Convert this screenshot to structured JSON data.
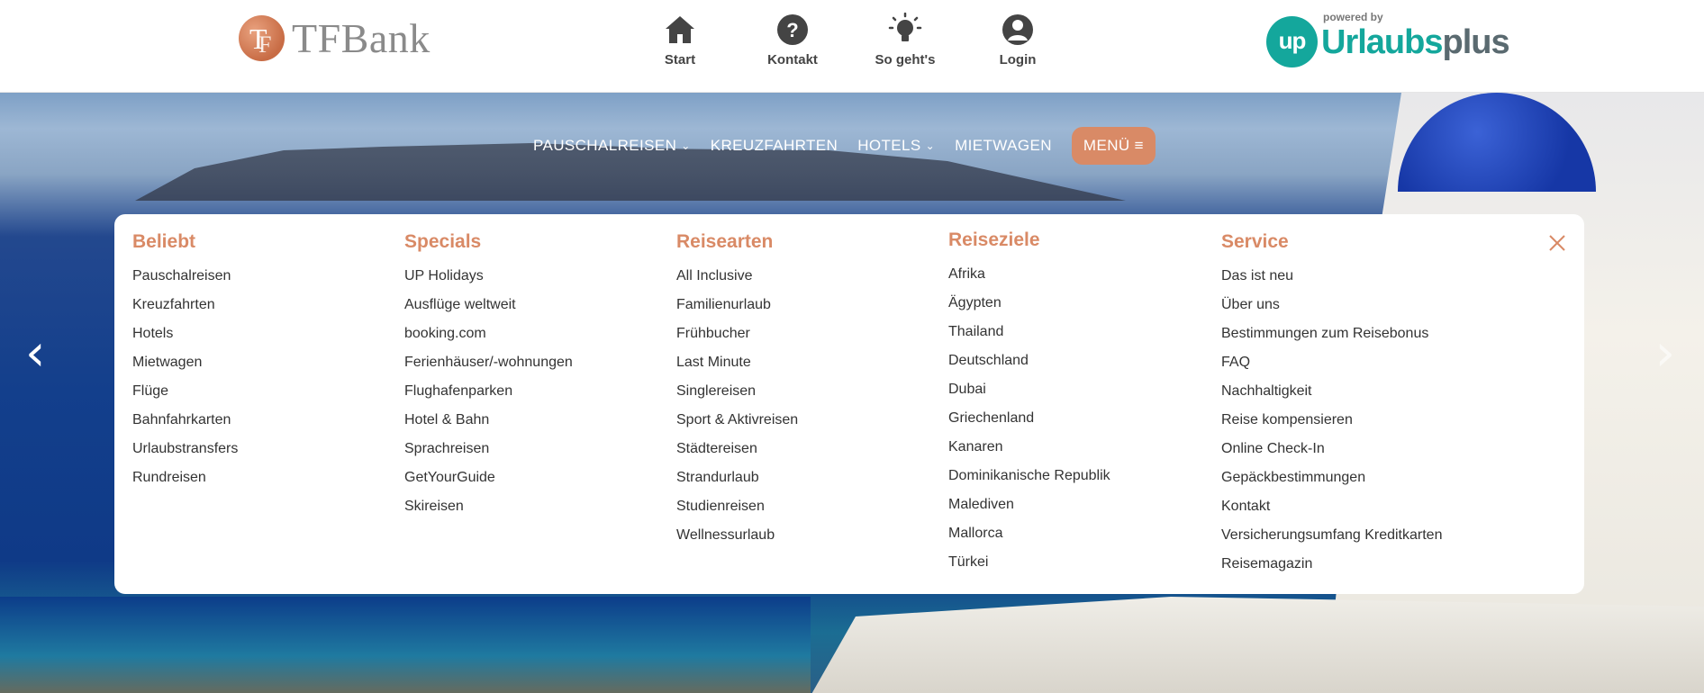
{
  "header": {
    "logo_text": "TFBank",
    "nav": [
      {
        "label": "Start",
        "icon": "home-icon"
      },
      {
        "label": "Kontakt",
        "icon": "question-icon"
      },
      {
        "label": "So geht's",
        "icon": "lightbulb-icon"
      },
      {
        "label": "Login",
        "icon": "user-icon"
      }
    ],
    "partner": {
      "powered_by": "powered by",
      "mark": "up",
      "name_a": "Urlaubs",
      "name_b": "plus"
    }
  },
  "main_nav": {
    "items": [
      {
        "label": "PAUSCHALREISEN",
        "dropdown": true
      },
      {
        "label": "KREUZFAHRTEN",
        "dropdown": false
      },
      {
        "label": "HOTELS",
        "dropdown": true
      },
      {
        "label": "MIETWAGEN",
        "dropdown": false
      }
    ],
    "menu_button": "MENÜ ≡"
  },
  "carousel": {
    "prev": "‹",
    "next": "›"
  },
  "mega_menu": {
    "columns": [
      {
        "title": "Beliebt",
        "items": [
          "Pauschalreisen",
          "Kreuzfahrten",
          "Hotels",
          "Mietwagen",
          "Flüge",
          "Bahnfahrkarten",
          "Urlaubstransfers",
          "Rundreisen"
        ]
      },
      {
        "title": "Specials",
        "items": [
          "UP Holidays",
          "Ausflüge weltweit",
          "booking.com",
          "Ferienhäuser/-wohnungen",
          "Flughafenparken",
          "Hotel & Bahn",
          "Sprachreisen",
          "GetYourGuide",
          "Skireisen"
        ]
      },
      {
        "title": "Reisearten",
        "items": [
          "All Inclusive",
          "Familienurlaub",
          "Frühbucher",
          "Last Minute",
          "Singlereisen",
          "Sport & Aktivreisen",
          "Städtereisen",
          "Strandurlaub",
          "Studienreisen",
          "Wellnessurlaub"
        ]
      },
      {
        "title": "Reiseziele",
        "items": [
          "Afrika",
          "Ägypten",
          "Thailand",
          "Deutschland",
          "Dubai",
          "Griechenland",
          "Kanaren",
          "Dominikanische Republik",
          "Malediven",
          "Mallorca",
          "Türkei"
        ]
      },
      {
        "title": "Service",
        "items": [
          "Das ist neu",
          "Über uns",
          "Bestimmungen zum Reisebonus",
          "FAQ",
          "Nachhaltigkeit",
          "Reise kompensieren",
          "Online Check-In",
          "Gepäckbestimmungen",
          "Kontakt",
          "Versicherungsumfang Kreditkarten",
          "Reisemagazin"
        ]
      }
    ]
  },
  "colors": {
    "accent": "#d98a66",
    "partner": "#14a79c",
    "text": "#333333"
  }
}
